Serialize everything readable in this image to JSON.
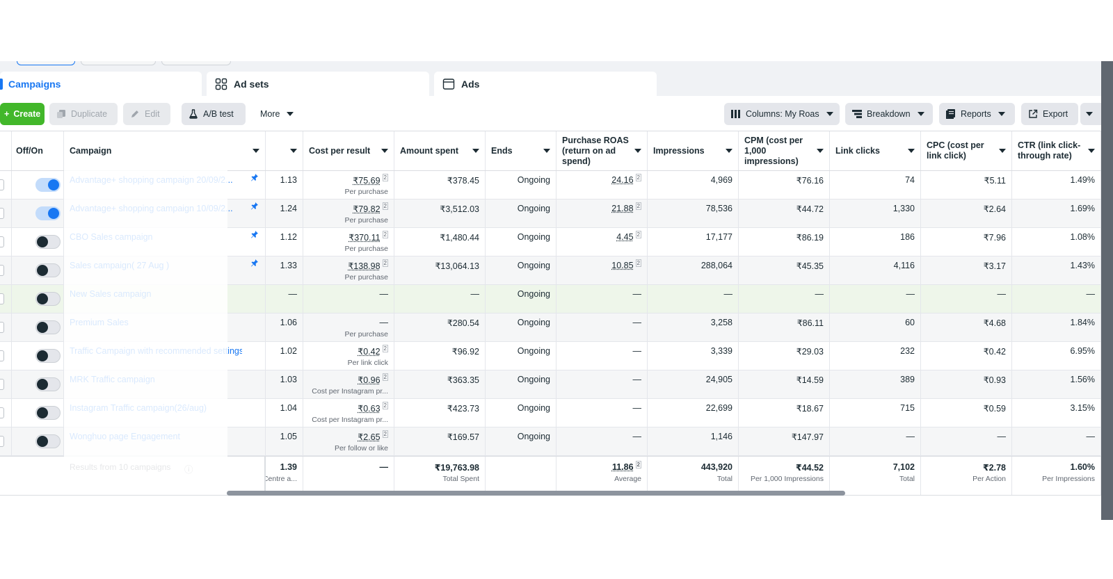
{
  "tabs": [
    {
      "label": "Campaigns"
    },
    {
      "label": "Ad sets"
    },
    {
      "label": "Ads"
    }
  ],
  "toolbar": {
    "create": "Create",
    "duplicate": "Duplicate",
    "edit": "Edit",
    "ab_test": "A/B test",
    "more": "More",
    "columns": "Columns: My Roas",
    "breakdown": "Breakdown",
    "reports": "Reports",
    "export": "Export"
  },
  "columns": {
    "offon": "Off/On",
    "campaign": "Campaign",
    "cost_per_result": "Cost per result",
    "amount_spent": "Amount spent",
    "ends": "Ends",
    "roas": "Purchase ROAS (return on ad spend)",
    "impressions": "Impressions",
    "cpm": "CPM (cost per 1,000 impressions)",
    "link_clicks": "Link clicks",
    "cpc": "CPC (cost per link click)",
    "ctr": "CTR (link click-through rate)"
  },
  "rows": [
    {
      "on": true,
      "pinned": true,
      "name": "Advantage+ shopping campaign 20/09/2...",
      "metric": "1.13",
      "cpr": "₹75.69",
      "cpr_sub": "Per purchase",
      "spent": "₹378.45",
      "ends": "Ongoing",
      "roas": "24.16",
      "impr": "4,969",
      "cpm": "₹76.16",
      "clicks": "74",
      "cpc": "₹5.11",
      "ctr": "1.49%"
    },
    {
      "on": true,
      "pinned": true,
      "name": "Advantage+ shopping campaign 10/09/2...",
      "metric": "1.24",
      "cpr": "₹79.82",
      "cpr_sub": "Per purchase",
      "spent": "₹3,512.03",
      "ends": "Ongoing",
      "roas": "21.88",
      "impr": "78,536",
      "cpm": "₹44.72",
      "clicks": "1,330",
      "cpc": "₹2.64",
      "ctr": "1.69%"
    },
    {
      "on": false,
      "pinned": true,
      "name": "CBO Sales campaign",
      "metric": "1.12",
      "cpr": "₹370.11",
      "cpr_sub": "Per purchase",
      "spent": "₹1,480.44",
      "ends": "Ongoing",
      "roas": "4.45",
      "impr": "17,177",
      "cpm": "₹86.19",
      "clicks": "186",
      "cpc": "₹7.96",
      "ctr": "1.08%"
    },
    {
      "on": false,
      "pinned": true,
      "name": "Sales campaign( 27 Aug )",
      "metric": "1.33",
      "cpr": "₹138.98",
      "cpr_sub": "Per purchase",
      "spent": "₹13,064.13",
      "ends": "Ongoing",
      "roas": "10.85",
      "impr": "288,064",
      "cpm": "₹45.35",
      "clicks": "4,116",
      "cpc": "₹3.17",
      "ctr": "1.43%"
    },
    {
      "on": false,
      "pinned": false,
      "name": "New Sales campaign",
      "metric": "—",
      "cpr": "—",
      "cpr_sub": "",
      "spent": "—",
      "ends": "Ongoing",
      "roas": "—",
      "impr": "—",
      "cpm": "—",
      "clicks": "—",
      "cpc": "—",
      "ctr": "—"
    },
    {
      "on": false,
      "pinned": false,
      "name": "Premium Sales",
      "metric": "1.06",
      "cpr": "—",
      "cpr_sub": "Per purchase",
      "spent": "₹280.54",
      "ends": "Ongoing",
      "roas": "—",
      "impr": "3,258",
      "cpm": "₹86.11",
      "clicks": "60",
      "cpc": "₹4.68",
      "ctr": "1.84%"
    },
    {
      "on": false,
      "pinned": false,
      "name": "Traffic Campaign with recommended settings",
      "metric": "1.02",
      "cpr": "₹0.42",
      "cpr_sub": "Per link click",
      "spent": "₹96.92",
      "ends": "Ongoing",
      "roas": "—",
      "impr": "3,339",
      "cpm": "₹29.03",
      "clicks": "232",
      "cpc": "₹0.42",
      "ctr": "6.95%"
    },
    {
      "on": false,
      "pinned": false,
      "name": "MRK Traffic campaign",
      "metric": "1.03",
      "cpr": "₹0.96",
      "cpr_sub": "Cost per Instagram pr...",
      "spent": "₹363.35",
      "ends": "Ongoing",
      "roas": "—",
      "impr": "24,905",
      "cpm": "₹14.59",
      "clicks": "389",
      "cpc": "₹0.93",
      "ctr": "1.56%"
    },
    {
      "on": false,
      "pinned": false,
      "name": "Instagram Traffic campaign(26/aug)",
      "metric": "1.04",
      "cpr": "₹0.63",
      "cpr_sub": "Cost per Instagram pr...",
      "spent": "₹423.73",
      "ends": "Ongoing",
      "roas": "—",
      "impr": "22,699",
      "cpm": "₹18.67",
      "clicks": "715",
      "cpc": "₹0.59",
      "ctr": "3.15%"
    },
    {
      "on": false,
      "pinned": false,
      "name": "Wonghuo page Engagement",
      "metric": "1.05",
      "cpr": "₹2.65",
      "cpr_sub": "Per follow or like",
      "spent": "₹169.57",
      "ends": "Ongoing",
      "roas": "—",
      "impr": "1,146",
      "cpm": "₹147.97",
      "clicks": "—",
      "cpc": "—",
      "ctr": "—"
    }
  ],
  "footer": {
    "label": "Results from 10 campaigns",
    "metric": "1.39",
    "metric_sub": "Centre a...",
    "cpr": "—",
    "spent": "₹19,763.98",
    "spent_sub": "Total Spent",
    "roas": "11.86",
    "roas_sub": "Average",
    "impr": "443,920",
    "impr_sub": "Total",
    "cpm": "₹44.52",
    "cpm_sub": "Per 1,000 Impressions",
    "clicks": "7,102",
    "clicks_sub": "Total",
    "cpc": "₹2.78",
    "cpc_sub": "Per Action",
    "ctr": "1.60%",
    "ctr_sub": "Per Impressions"
  },
  "colors": {
    "accent": "#1877f2",
    "create": "#42b72a"
  }
}
